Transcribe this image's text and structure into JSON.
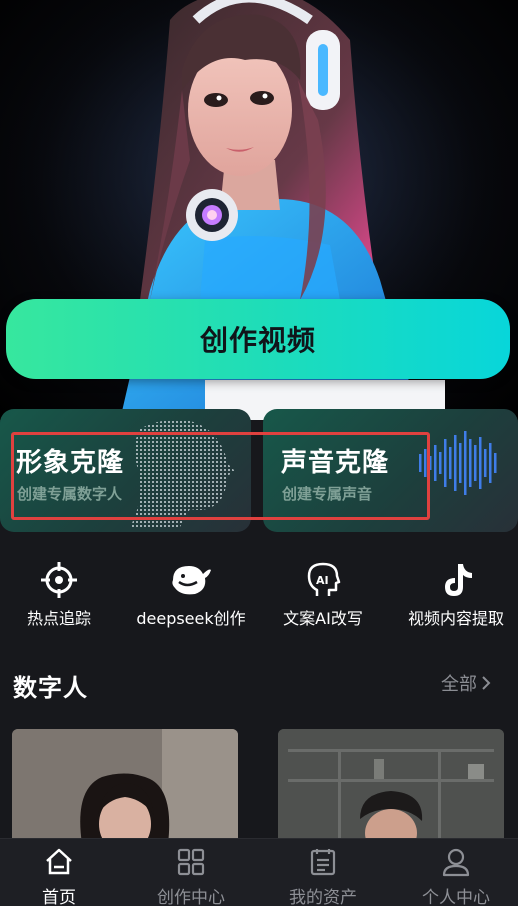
{
  "hero": {
    "create_button_label": "创作视频"
  },
  "clone_cards": [
    {
      "title": "形象克隆",
      "subtitle": "创建专属数字人",
      "icon": "digital-face-icon"
    },
    {
      "title": "声音克隆",
      "subtitle": "创建专属声音",
      "icon": "sound-wave-icon"
    }
  ],
  "tools": [
    {
      "label": "热点追踪",
      "icon": "crosshair-icon"
    },
    {
      "label": "deepseek创作",
      "icon": "whale-icon"
    },
    {
      "label": "文案AI改写",
      "icon": "ai-head-icon"
    },
    {
      "label": "视频内容提取",
      "icon": "tiktok-icon"
    }
  ],
  "digital_humans": {
    "title": "数字人",
    "more_label": "全部"
  },
  "bottom_nav": [
    {
      "label": "首页",
      "icon": "home-icon",
      "active": true
    },
    {
      "label": "创作中心",
      "icon": "grid-icon",
      "active": false
    },
    {
      "label": "我的资产",
      "icon": "document-icon",
      "active": false
    },
    {
      "label": "个人中心",
      "icon": "user-icon",
      "active": false
    }
  ],
  "colors": {
    "accent_gradient_start": "#37e79e",
    "accent_gradient_end": "#08d6da",
    "background": "#17181c",
    "highlight_box": "#e0413f"
  }
}
